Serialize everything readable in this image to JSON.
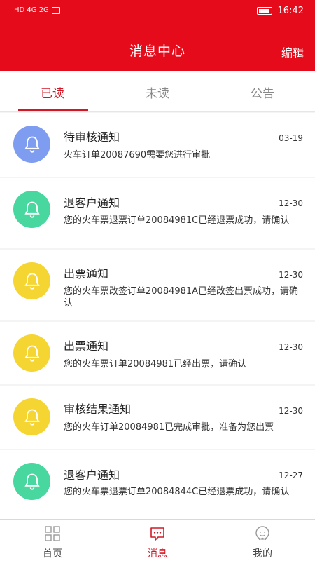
{
  "status_bar": {
    "left_text": "HD 4G 2G",
    "time": "16:42"
  },
  "header": {
    "title": "消息中心",
    "edit_label": "编辑",
    "color": "#e50b1b"
  },
  "tabs": [
    {
      "label": "已读",
      "active": true
    },
    {
      "label": "未读",
      "active": false
    },
    {
      "label": "公告",
      "active": false
    }
  ],
  "messages": [
    {
      "title": "待审核通知",
      "date": "03-19",
      "body": "火车订单20087690需要您进行审批",
      "icon_color": "#7f9df0",
      "icon": "bell-icon"
    },
    {
      "title": "退客户通知",
      "date": "12-30",
      "body": "您的火车票退票订单20084981C已经退票成功，请确认",
      "icon_color": "#49d7a0",
      "icon": "bell-icon"
    },
    {
      "title": "出票通知",
      "date": "12-30",
      "body": "您的火车票改签订单20084981A已经改签出票成功，请确认",
      "icon_color": "#f5d531",
      "icon": "bell-icon"
    },
    {
      "title": "出票通知",
      "date": "12-30",
      "body": "您的火车票订单20084981已经出票，请确认",
      "icon_color": "#f5d531",
      "icon": "bell-icon"
    },
    {
      "title": "审核结果通知",
      "date": "12-30",
      "body": "您的火车订单20084981已完成审批，准备为您出票",
      "icon_color": "#f5d531",
      "icon": "bell-icon"
    },
    {
      "title": "退客户通知",
      "date": "12-27",
      "body": "您的火车票退票订单20084844C已经退票成功，请确认",
      "icon_color": "#49d7a0",
      "icon": "bell-icon"
    }
  ],
  "bottom_nav": [
    {
      "label": "首页",
      "icon": "grid-icon",
      "active": false
    },
    {
      "label": "消息",
      "icon": "message-icon",
      "active": true
    },
    {
      "label": "我的",
      "icon": "profile-icon",
      "active": false
    }
  ],
  "accent_color": "#d21826"
}
